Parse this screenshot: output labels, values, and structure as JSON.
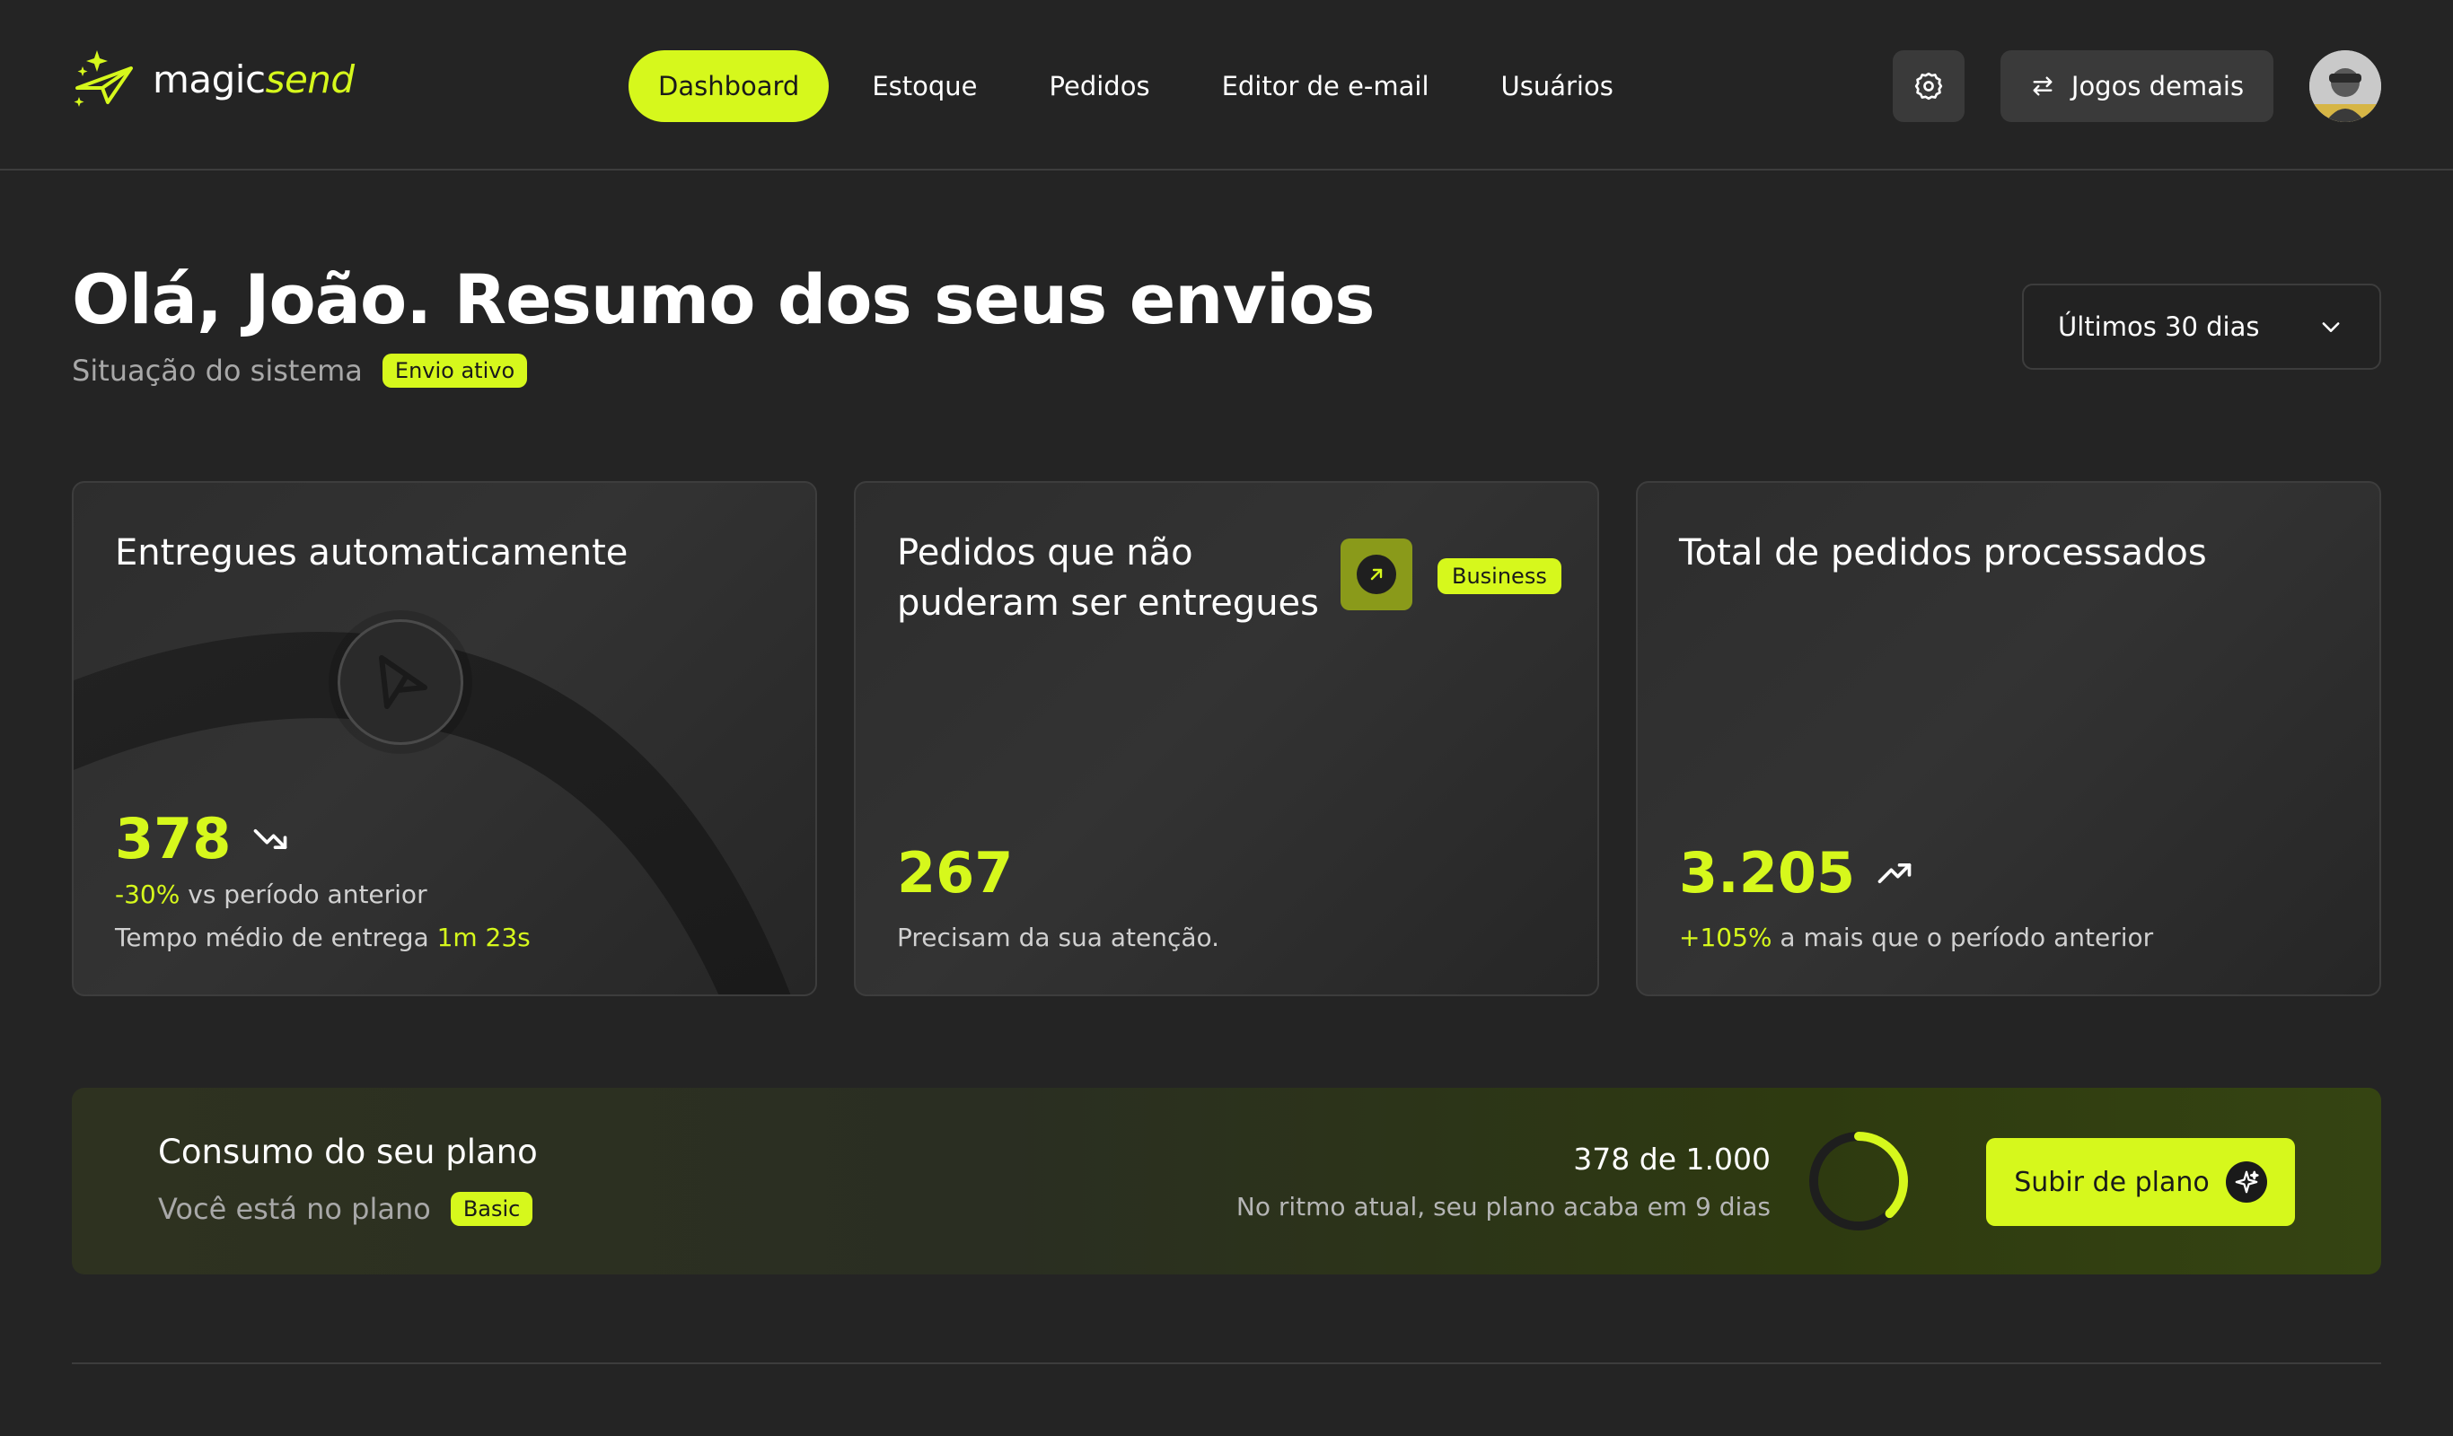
{
  "brand": {
    "name_plain": "magic",
    "name_accent": "send"
  },
  "colors": {
    "accent": "#d6f81c",
    "background": "#242424",
    "card_border": "#3d3d3d"
  },
  "nav": {
    "items": [
      {
        "label": "Dashboard",
        "active": true
      },
      {
        "label": "Estoque",
        "active": false
      },
      {
        "label": "Pedidos",
        "active": false
      },
      {
        "label": "Editor de e-mail",
        "active": false
      },
      {
        "label": "Usuários",
        "active": false
      }
    ]
  },
  "header": {
    "settings_icon": "gear-icon",
    "switch_icon": "swap-arrows-icon",
    "switch_label": "Jogos demais"
  },
  "hero": {
    "greeting": "Olá, João. Resumo dos seus envios",
    "status_label": "Situação do sistema",
    "status_badge": "Envio ativo",
    "period_selected": "Últimos 30 dias"
  },
  "cards": [
    {
      "title": "Entregues automaticamente",
      "value": "378",
      "trend_icon": "trend-down-icon",
      "delta": "-30%",
      "delta_text": "vs período anterior",
      "extra_label": "Tempo médio de entrega",
      "extra_value": "1m 23s",
      "icon": "send-icon"
    },
    {
      "title": "Pedidos que não puderam ser entregues",
      "badge": "Business",
      "action_icon": "arrow-up-right-icon",
      "value": "267",
      "note": "Precisam da sua atenção."
    },
    {
      "title": "Total de pedidos processados",
      "value": "3.205",
      "trend_icon": "trend-up-icon",
      "delta": "+105%",
      "delta_text": "a mais que o período anterior"
    }
  ],
  "plan": {
    "title": "Consumo do seu plano",
    "subtitle": "Você está no plano",
    "plan_badge": "Basic",
    "usage_text": "378 de 1.000",
    "usage_fraction": 0.378,
    "forecast": "No ritmo atual, seu plano acaba em 9 dias",
    "upgrade_label": "Subir de plano",
    "upgrade_icon": "sparkle-icon"
  }
}
